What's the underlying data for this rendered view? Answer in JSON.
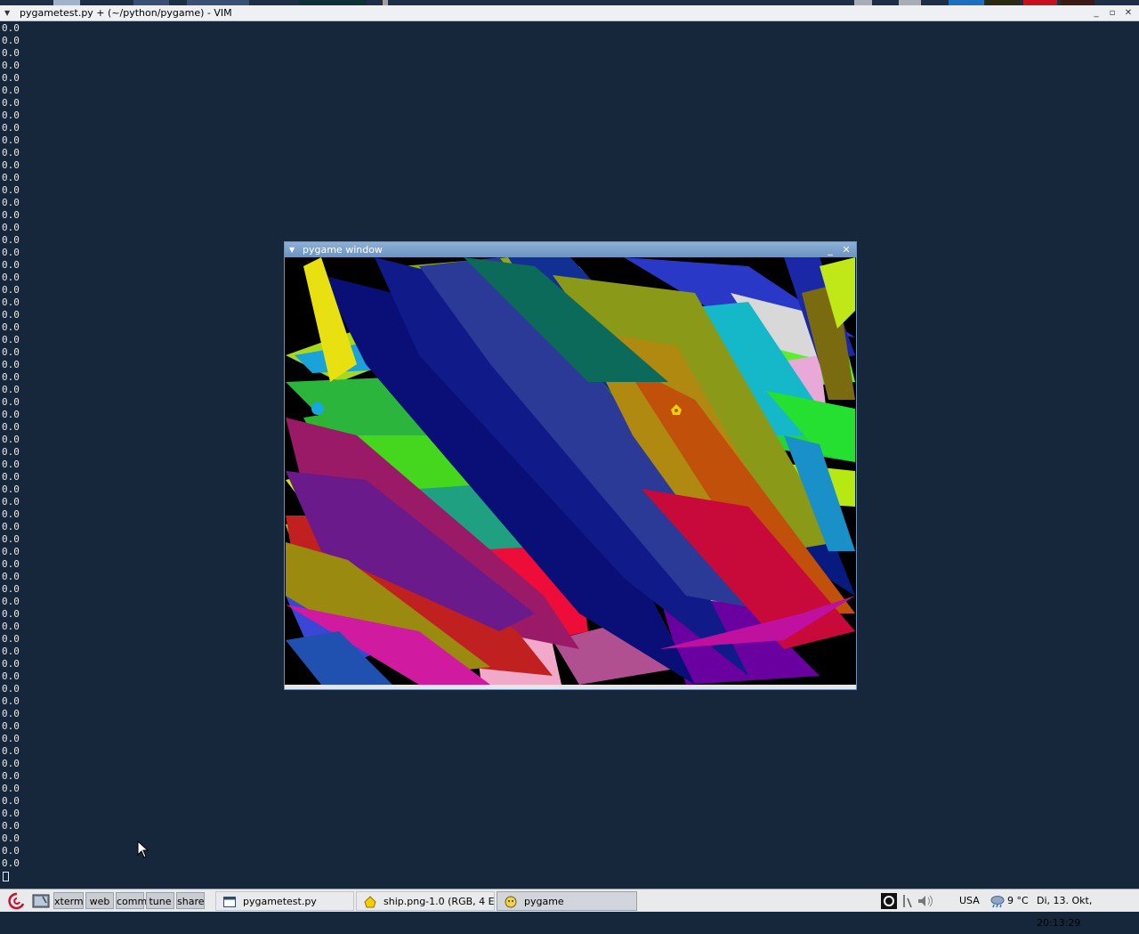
{
  "vim_window": {
    "title": "pygametest.py + (~/python/pygame) - VIM",
    "controls": {
      "minimize": "_",
      "maximize": "▫",
      "close": "✕"
    }
  },
  "terminal": {
    "line_text": "0.0",
    "line_count": 68
  },
  "pygame_window": {
    "title": "pygame window",
    "controls": {
      "minimize": "_",
      "close": "✕"
    }
  },
  "taskbar": {
    "pager": [
      "xterm",
      "web",
      "comm",
      "tune",
      "share"
    ],
    "active_pager": "xterm",
    "tasks": [
      {
        "label": "pygametest.py",
        "icon": "terminal-icon"
      },
      {
        "label": "ship.png-1.0 (RGB, 4 E...",
        "icon": "image-icon"
      },
      {
        "label": "pygame",
        "icon": "pygame-icon"
      }
    ],
    "active_task": "pygame",
    "tray": {
      "keyboard_layout": "USA",
      "temperature": "9 °C",
      "clock": "Di, 13. Okt, 20:13:29"
    }
  },
  "colors": {
    "desktop_background": "#16263b",
    "terminal_text": "#e8e8e8",
    "pygame_title_bar": "#7ba0ca",
    "taskbar_background": "#e9eaec",
    "pager_active": "#4f76a8"
  }
}
